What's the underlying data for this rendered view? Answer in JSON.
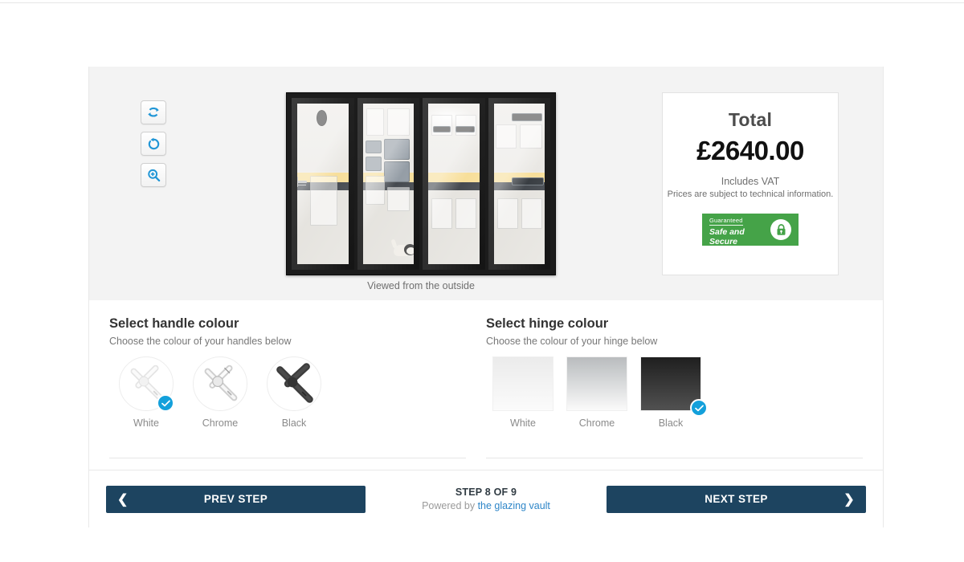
{
  "preview": {
    "caption": "Viewed from the outside",
    "tools": [
      {
        "name": "flip-horizontal-icon",
        "label": "Flip view"
      },
      {
        "name": "rotate-icon",
        "label": "Rotate view"
      },
      {
        "name": "zoom-in-icon",
        "label": "Zoom in"
      }
    ],
    "door": {
      "type": "bifold-door",
      "panel_count": 4,
      "frame_colour": "#1c1c1c",
      "scene": "kitchen interior with dog"
    }
  },
  "total": {
    "label": "Total",
    "amount": "£2640.00",
    "vat_note": "Includes VAT",
    "disclaimer": "Prices are subject to technical information.",
    "badge": {
      "eyebrow": "Guaranteed",
      "line1": "Safe and",
      "line2": "Secure",
      "colour": "#45a348",
      "icon": "padlock-icon"
    }
  },
  "options": [
    {
      "id": "handle-colour",
      "title": "Select handle colour",
      "subtitle": "Choose the colour of your handles below",
      "style": "handle",
      "swatches": [
        {
          "label": "White",
          "value": "white",
          "selected": true
        },
        {
          "label": "Chrome",
          "value": "chrome",
          "selected": false
        },
        {
          "label": "Black",
          "value": "black",
          "selected": false
        }
      ]
    },
    {
      "id": "hinge-colour",
      "title": "Select hinge colour",
      "subtitle": "Choose the colour of your hinge below",
      "style": "hinge",
      "swatches": [
        {
          "label": "White",
          "value": "white",
          "selected": false
        },
        {
          "label": "Chrome",
          "value": "chrome",
          "selected": false
        },
        {
          "label": "Black",
          "value": "black",
          "selected": true
        }
      ]
    }
  ],
  "footer": {
    "prev_label": "PREV STEP",
    "next_label": "NEXT STEP",
    "step_label": "STEP 8 OF 9",
    "powered_prefix": "Powered by ",
    "powered_link": "the glazing vault",
    "accent": "#1d4460",
    "link_colour": "#2e86c8"
  }
}
